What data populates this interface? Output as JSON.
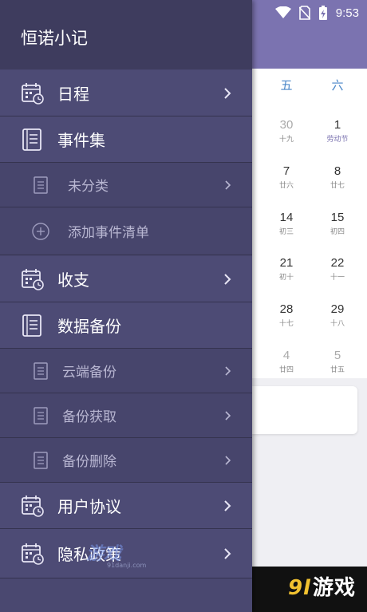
{
  "status_bar": {
    "time": "9:53",
    "icons": [
      "wifi-icon",
      "no-sim-icon",
      "battery-charging-icon"
    ]
  },
  "drawer": {
    "title": "恒诺小记",
    "items": [
      {
        "label": "日程",
        "icon": "calendar-clock-icon",
        "chevron": true
      },
      {
        "label": "事件集",
        "icon": "notebook-icon",
        "chevron": false
      },
      {
        "label": "未分类",
        "icon": "document-icon",
        "chevron": true
      },
      {
        "label": "添加事件清单",
        "icon": "plus-circle-icon",
        "chevron": false
      },
      {
        "label": "收支",
        "icon": "calendar-clock-icon",
        "chevron": true
      },
      {
        "label": "数据备份",
        "icon": "notebook-icon",
        "chevron": false
      },
      {
        "label": "云端备份",
        "icon": "document-icon",
        "chevron": true
      },
      {
        "label": "备份获取",
        "icon": "document-icon",
        "chevron": true
      },
      {
        "label": "备份删除",
        "icon": "document-icon",
        "chevron": true
      },
      {
        "label": "用户协议",
        "icon": "calendar-clock-icon",
        "chevron": true
      },
      {
        "label": "隐私政策",
        "icon": "calendar-clock-icon",
        "chevron": true
      }
    ]
  },
  "calendar": {
    "headers": [
      "五",
      "六"
    ],
    "weeks": [
      [
        {
          "day": "30",
          "sub": "十九",
          "grey": true
        },
        {
          "day": "1",
          "sub": "劳动节",
          "grey": false,
          "highlight": true
        }
      ],
      [
        {
          "day": "7",
          "sub": "廿六"
        },
        {
          "day": "8",
          "sub": "廿七"
        }
      ],
      [
        {
          "day": "14",
          "sub": "初三"
        },
        {
          "day": "15",
          "sub": "初四"
        }
      ],
      [
        {
          "day": "21",
          "sub": "初十"
        },
        {
          "day": "22",
          "sub": "十一"
        }
      ],
      [
        {
          "day": "28",
          "sub": "十七"
        },
        {
          "day": "29",
          "sub": "十八"
        }
      ],
      [
        {
          "day": "4",
          "sub": "廿四",
          "grey": true
        },
        {
          "day": "5",
          "sub": "廿五",
          "grey": true
        }
      ]
    ]
  },
  "watermarks": {
    "overlay_text": "游戏",
    "overlay_url": "91danji.com",
    "corner_logo": "9l",
    "corner_text": "游戏"
  },
  "colors": {
    "accent": "#7b73b0",
    "drawer": "#4a4870",
    "header_blue": "#4a86c8"
  }
}
